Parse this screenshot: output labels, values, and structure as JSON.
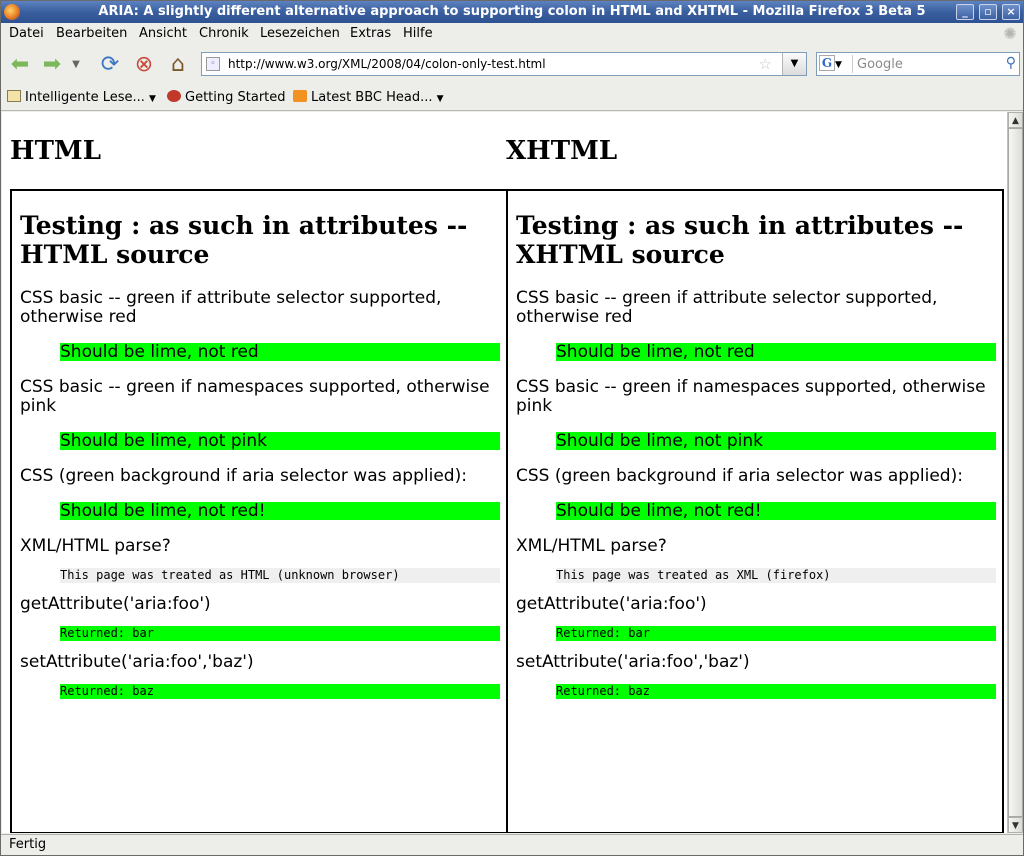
{
  "window": {
    "title": "ARIA: A slightly different alternative approach to supporting colon in HTML and XHTML - Mozilla Firefox 3 Beta 5",
    "minimize_icon": "minimize-icon",
    "maximize_icon": "maximize-icon",
    "close_icon": "close-icon"
  },
  "menu": [
    "Datei",
    "Bearbeiten",
    "Ansicht",
    "Chronik",
    "Lesezeichen",
    "Extras",
    "Hilfe"
  ],
  "nav": {
    "url": "http://www.w3.org/XML/2008/04/colon-only-test.html",
    "search_placeholder": "Google"
  },
  "bookmarks": [
    {
      "label": "Intelligente Lese...",
      "icon": "folder-icon"
    },
    {
      "label": "Getting Started",
      "icon": "firefox-icon"
    },
    {
      "label": "Latest BBC Head...",
      "icon": "rss-icon"
    }
  ],
  "page": {
    "col_html": "HTML",
    "col_xhtml": "XHTML",
    "left": {
      "heading": "Testing : as such in attributes -- HTML source",
      "q1": "CSS basic -- green if attribute selector supported, otherwise red",
      "r1": "Should be lime, not red",
      "q2": "CSS basic -- green if namespaces supported, otherwise pink",
      "r2": "Should be lime, not pink",
      "q3": "CSS (green background if aria selector was applied):",
      "r3": "Should be lime, not red!",
      "q4": "XML/HTML parse?",
      "r4": "This page was treated as HTML (unknown browser)",
      "q5": "getAttribute('aria:foo')",
      "r5": "Returned: bar",
      "q6": "setAttribute('aria:foo','baz')",
      "r6": "Returned: baz"
    },
    "right": {
      "heading": "Testing : as such in attributes -- XHTML source",
      "q1": "CSS basic -- green if attribute selector supported, otherwise red",
      "r1": "Should be lime, not red",
      "q2": "CSS basic -- green if namespaces supported, otherwise pink",
      "r2": "Should be lime, not pink",
      "q3": "CSS (green background if aria selector was applied):",
      "r3": "Should be lime, not red!",
      "q4": "XML/HTML parse?",
      "r4": "This page was treated as XML (firefox)",
      "q5": "getAttribute('aria:foo')",
      "r5": "Returned: bar",
      "q6": "setAttribute('aria:foo','baz')",
      "r6": "Returned: baz"
    }
  },
  "status": "Fertig",
  "colors": {
    "pass": "#00ff00",
    "titlebar": "#3a5f9e",
    "parse_bg": "#efefef"
  }
}
